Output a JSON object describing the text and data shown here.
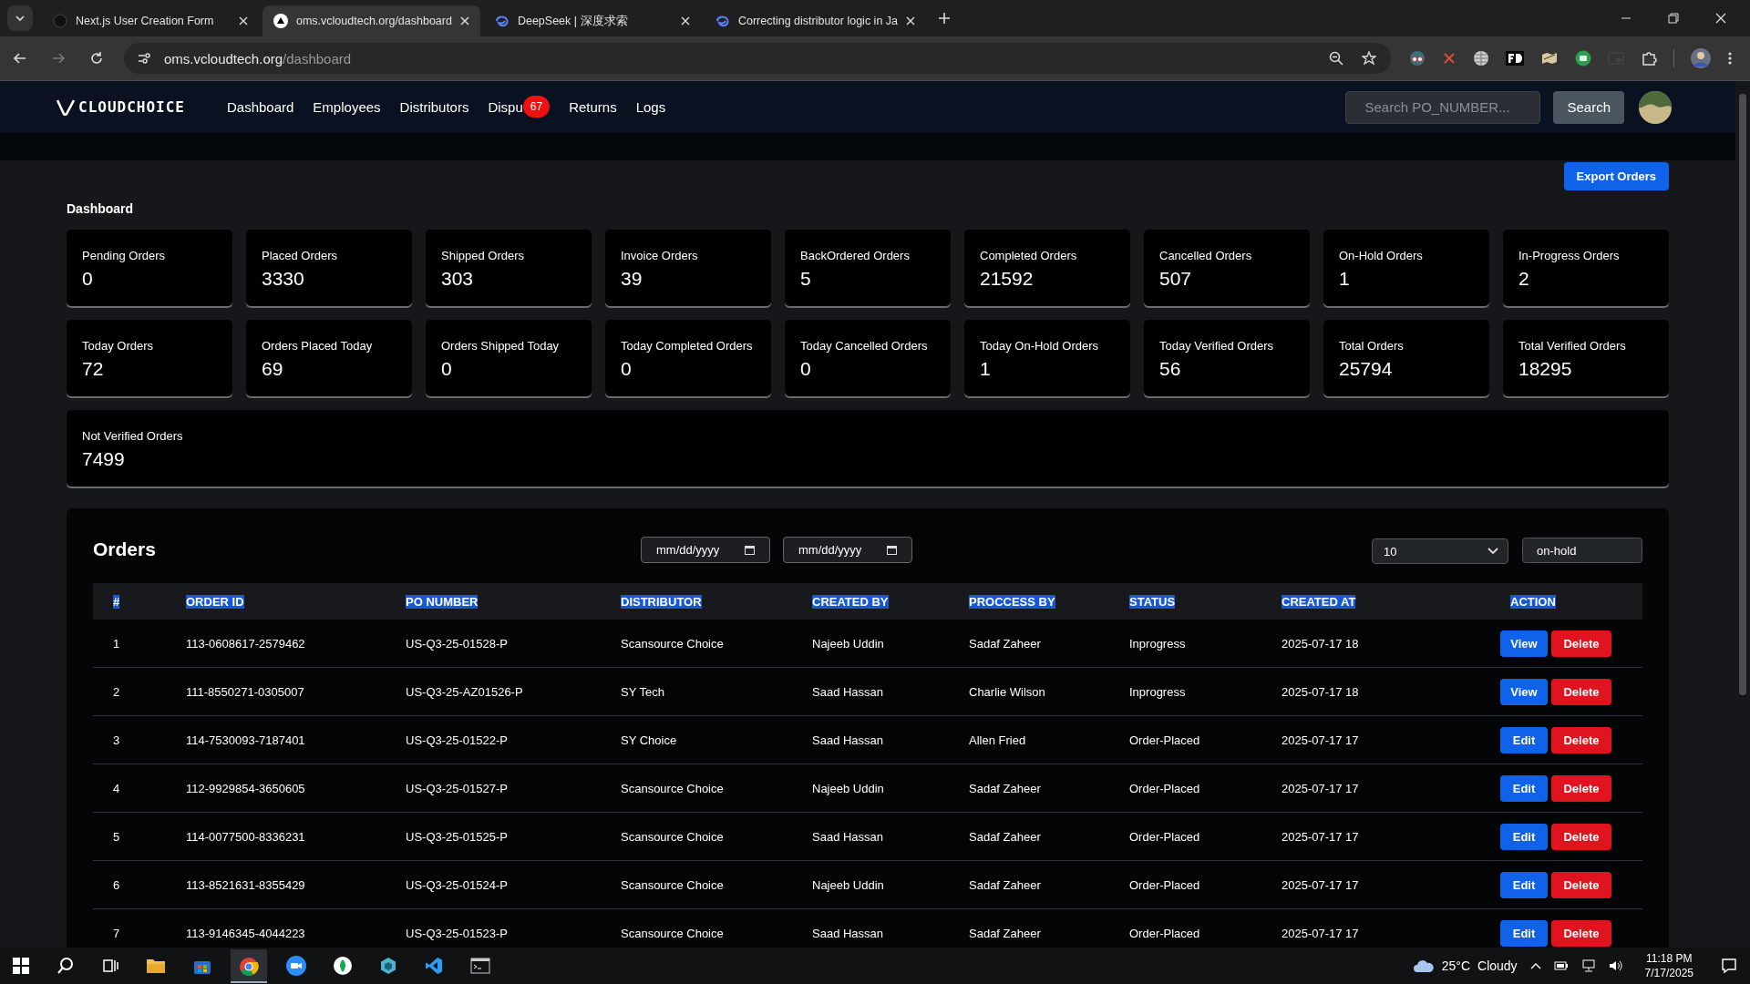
{
  "browser": {
    "tabs": [
      {
        "title": "Next.js User Creation Form",
        "kind": "dark",
        "selected": false
      },
      {
        "title": "oms.vcloudtech.org/dashboard",
        "kind": "triangle",
        "selected": true
      },
      {
        "title": "DeepSeek | 深度求索",
        "kind": "swirl",
        "selected": false
      },
      {
        "title": "Correcting distributor logic in Ja",
        "kind": "swirl",
        "selected": false
      }
    ],
    "url": {
      "host": "oms.vcloudtech.org",
      "path": "/dashboard"
    }
  },
  "nav": {
    "logo": "CLOUDCHOICE",
    "items": [
      {
        "label": "Dashboard"
      },
      {
        "label": "Employees"
      },
      {
        "label": "Distributors"
      },
      {
        "label": "Dispu",
        "badge": "67"
      },
      {
        "label": "Returns"
      },
      {
        "label": "Logs"
      }
    ],
    "search": {
      "placeholder": "Search PO_NUMBER..."
    },
    "search_button": "Search"
  },
  "export_button": "Export Orders",
  "heading": "Dashboard",
  "stats": [
    {
      "label": "Pending Orders",
      "value": "0"
    },
    {
      "label": "Placed Orders",
      "value": "3330"
    },
    {
      "label": "Shipped Orders",
      "value": "303"
    },
    {
      "label": "Invoice Orders",
      "value": "39"
    },
    {
      "label": "BackOrdered Orders",
      "value": "5"
    },
    {
      "label": "Completed Orders",
      "value": "21592"
    },
    {
      "label": "Cancelled Orders",
      "value": "507"
    },
    {
      "label": "On-Hold Orders",
      "value": "1"
    },
    {
      "label": "In-Progress Orders",
      "value": "2"
    },
    {
      "label": "Today Orders",
      "value": "72"
    },
    {
      "label": "Orders Placed Today",
      "value": "69"
    },
    {
      "label": "Orders Shipped Today",
      "value": "0"
    },
    {
      "label": "Today Completed Orders",
      "value": "0"
    },
    {
      "label": "Today Cancelled Orders",
      "value": "0"
    },
    {
      "label": "Today On-Hold Orders",
      "value": "1"
    },
    {
      "label": "Today Verified Orders",
      "value": "56"
    },
    {
      "label": "Total Orders",
      "value": "25794"
    },
    {
      "label": "Total Verified Orders",
      "value": "18295"
    }
  ],
  "wide_stat": {
    "label": "Not Verified Orders",
    "value": "7499"
  },
  "orders": {
    "title": "Orders",
    "date_from": "mm/dd/yyyy",
    "date_to": "mm/dd/yyyy",
    "page_size": "10",
    "status_filter": "on-hold",
    "header_selected": true,
    "columns": [
      "#",
      "ORDER ID",
      "PO NUMBER",
      "DISTRIBUTOR",
      "CREATED BY",
      "PROCCESS BY",
      "STATUS",
      "CREATED AT",
      "ACTION"
    ],
    "rows": [
      {
        "cells": [
          "1",
          "113-0608617-2579462",
          "US-Q3-25-01528-P",
          "Scansource Choice",
          "Najeeb Uddin",
          "Sadaf Zaheer",
          "Inprogress",
          "2025-07-17 18"
        ],
        "actions": [
          {
            "label": "View",
            "kind": "primary"
          },
          {
            "label": "Delete",
            "kind": "danger"
          }
        ]
      },
      {
        "cells": [
          "2",
          "111-8550271-0305007",
          "US-Q3-25-AZ01526-P",
          "SY Tech",
          "Saad Hassan",
          "Charlie Wilson",
          "Inprogress",
          "2025-07-17 18"
        ],
        "actions": [
          {
            "label": "View",
            "kind": "primary"
          },
          {
            "label": "Delete",
            "kind": "danger"
          }
        ]
      },
      {
        "cells": [
          "3",
          "114-7530093-7187401",
          "US-Q3-25-01522-P",
          "SY Choice",
          "Saad Hassan",
          "Allen Fried",
          "Order-Placed",
          "2025-07-17 17"
        ],
        "actions": [
          {
            "label": "Edit",
            "kind": "primary"
          },
          {
            "label": "Delete",
            "kind": "danger"
          }
        ]
      },
      {
        "cells": [
          "4",
          "112-9929854-3650605",
          "US-Q3-25-01527-P",
          "Scansource Choice",
          "Najeeb Uddin",
          "Sadaf Zaheer",
          "Order-Placed",
          "2025-07-17 17"
        ],
        "actions": [
          {
            "label": "Edit",
            "kind": "primary"
          },
          {
            "label": "Delete",
            "kind": "danger"
          }
        ]
      },
      {
        "cells": [
          "5",
          "114-0077500-8336231",
          "US-Q3-25-01525-P",
          "Scansource Choice",
          "Saad Hassan",
          "Sadaf Zaheer",
          "Order-Placed",
          "2025-07-17 17"
        ],
        "actions": [
          {
            "label": "Edit",
            "kind": "primary"
          },
          {
            "label": "Delete",
            "kind": "danger"
          }
        ]
      },
      {
        "cells": [
          "6",
          "113-8521631-8355429",
          "US-Q3-25-01524-P",
          "Scansource Choice",
          "Najeeb Uddin",
          "Sadaf Zaheer",
          "Order-Placed",
          "2025-07-17 17"
        ],
        "actions": [
          {
            "label": "Edit",
            "kind": "primary"
          },
          {
            "label": "Delete",
            "kind": "danger"
          }
        ]
      },
      {
        "cells": [
          "7",
          "113-9146345-4044223",
          "US-Q3-25-01523-P",
          "Scansource Choice",
          "Saad Hassan",
          "Sadaf Zaheer",
          "Order-Placed",
          "2025-07-17 17"
        ],
        "actions": [
          {
            "label": "Edit",
            "kind": "primary"
          },
          {
            "label": "Delete",
            "kind": "danger"
          }
        ]
      }
    ]
  },
  "taskbar": {
    "temperature": "25°C",
    "weather": "Cloudy",
    "time": "11:18 PM",
    "date": "7/17/2025"
  }
}
